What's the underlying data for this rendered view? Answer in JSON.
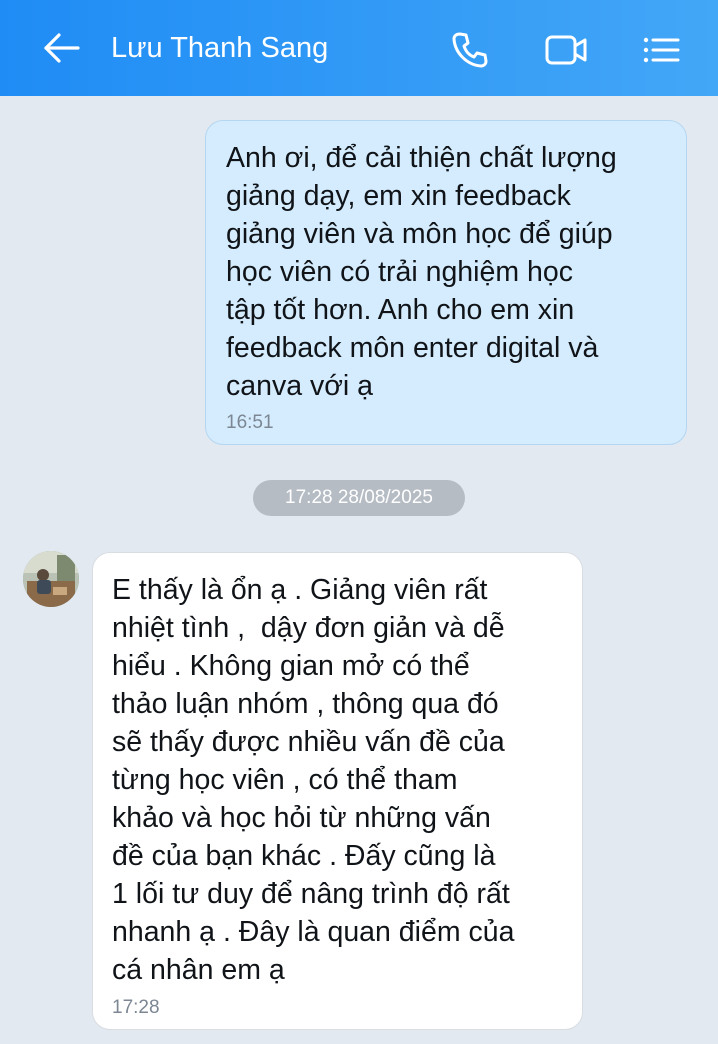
{
  "header": {
    "contact_name": "Lưu Thanh Sang",
    "back_icon": "arrow-left-icon",
    "call_icon": "phone-icon",
    "video_icon": "video-camera-icon",
    "menu_icon": "list-menu-icon"
  },
  "messages": {
    "outgoing": {
      "text": "Anh ơi, để cải thiện chất lượng\ngiảng dạy, em xin feedback\ngiảng viên và môn học để giúp\nhọc viên có trải nghiệm học\ntập tốt hơn. Anh cho em xin\nfeedback môn enter digital và\ncanva với ạ",
      "time": "16:51"
    },
    "date_separator": "17:28 28/08/2025",
    "incoming": {
      "text": "E thấy là ổn ạ . Giảng viên rất\nnhiệt tình ,  dậy đơn giản và dễ\nhiểu . Không gian mở có thể\nthảo luận nhóm , thông qua đó\nsẽ thấy được nhiều vấn đề của\ntừng học viên , có thể tham\nkhảo và học hỏi từ những vấn\nđề của bạn khác . Đấy cũng là\n1 lối tư duy để nâng trình độ rất\nnhanh ạ . Đây là quan điểm của\ncá nhân em ạ",
      "time": "17:28"
    }
  },
  "colors": {
    "header_start": "#1f8cf5",
    "header_end": "#43a7f7",
    "background": "#e2e9f1",
    "outgoing_bubble": "#d4ecfd",
    "incoming_bubble": "#ffffff"
  }
}
